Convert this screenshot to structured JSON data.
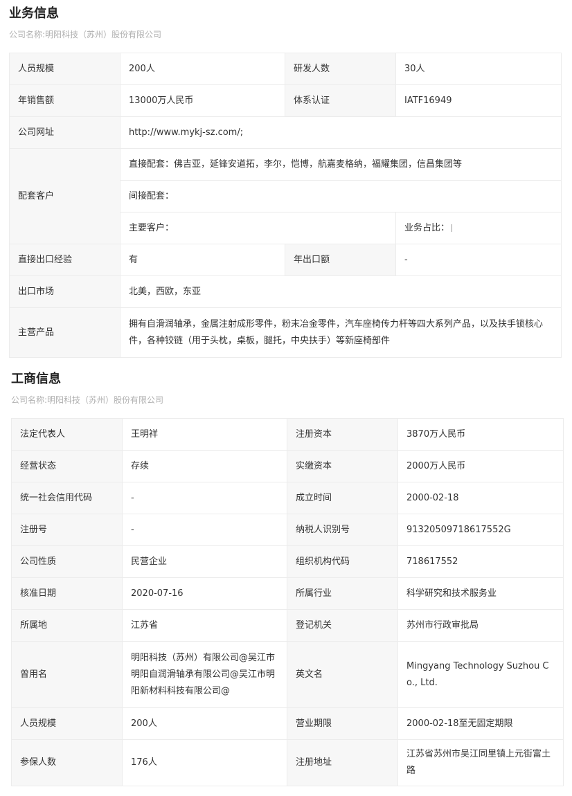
{
  "business": {
    "title": "业务信息",
    "company_line": "公司名称:明阳科技（苏州）股份有限公司",
    "rows": {
      "staff_label": "人员规模",
      "staff_value": "200人",
      "rd_label": "研发人数",
      "rd_value": "30人",
      "sales_label": "年销售额",
      "sales_value": "13000万人民币",
      "cert_label": "体系认证",
      "cert_value": "IATF16949",
      "web_label": "公司网址",
      "web_value": "http://www.mykj-sz.com/;",
      "clients_label": "配套客户",
      "direct_clients": "直接配套：佛吉亚，延锋安道拓，李尔，恺博，航嘉麦格纳，福耀集团，信昌集团等",
      "indirect_clients": "间接配套：",
      "main_clients": "主要客户：",
      "share_label": "业务占比：",
      "export_exp_label": "直接出口经验",
      "export_exp_value": "有",
      "export_amt_label": "年出口额",
      "export_amt_value": "-",
      "market_label": "出口市场",
      "market_value": "北美，西欧，东亚",
      "products_label": "主营产品",
      "products_value": "拥有自滑润轴承，金属注射成形零件，粉末冶金零件，汽车座椅传力杆等四大系列产品，以及扶手锁核心件，各种铰链（用于头枕，桌板，腿托，中央扶手）等新座椅部件"
    }
  },
  "registry": {
    "title": "工商信息",
    "company_line": "公司名称:明阳科技（苏州）股份有限公司",
    "rows": [
      {
        "l1": "法定代表人",
        "v1": "王明祥",
        "l2": "注册资本",
        "v2": "3870万人民币"
      },
      {
        "l1": "经营状态",
        "v1": "存续",
        "l2": "实缴资本",
        "v2": "2000万人民币"
      },
      {
        "l1": "统一社会信用代码",
        "v1": "-",
        "l2": "成立时间",
        "v2": "2000-02-18"
      },
      {
        "l1": "注册号",
        "v1": "-",
        "l2": "纳税人识别号",
        "v2": "91320509718617552G"
      },
      {
        "l1": "公司性质",
        "v1": "民营企业",
        "l2": "组织机构代码",
        "v2": "718617552"
      },
      {
        "l1": "核准日期",
        "v1": "2020-07-16",
        "l2": "所属行业",
        "v2": "科学研究和技术服务业"
      },
      {
        "l1": "所属地",
        "v1": "江苏省",
        "l2": "登记机关",
        "v2": "苏州市行政审批局"
      },
      {
        "l1": "曾用名",
        "v1": "明阳科技（苏州）有限公司@吴江市明阳自润滑轴承有限公司@吴江市明阳新材料科技有限公司@",
        "l2": "英文名",
        "v2": "Mingyang Technology Suzhou Co., Ltd."
      },
      {
        "l1": "人员规模",
        "v1": "200人",
        "l2": "营业期限",
        "v2": "2000-02-18至无固定期限"
      },
      {
        "l1": "参保人数",
        "v1": "176人",
        "l2": "注册地址",
        "v2": "江苏省苏州市吴江同里镇上元街富土路"
      }
    ]
  }
}
